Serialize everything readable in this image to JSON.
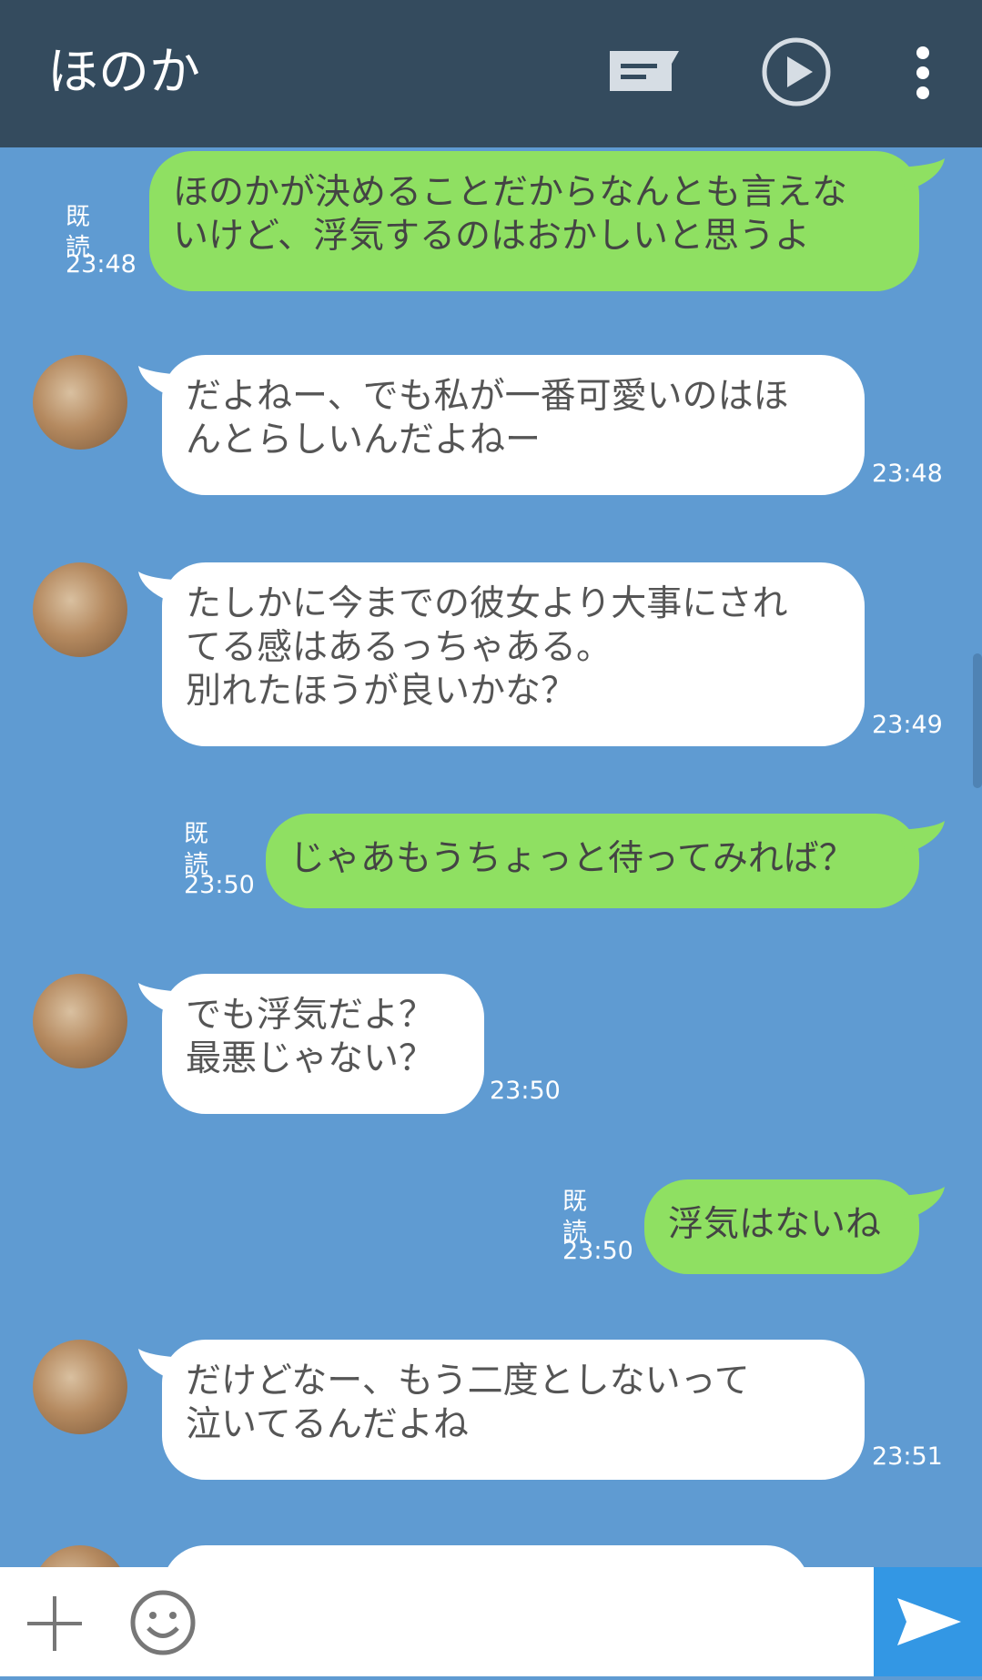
{
  "header": {
    "contact_name": "ほのか",
    "icons": [
      "chat-icon",
      "play-icon",
      "more-vertical-icon"
    ]
  },
  "messages": [
    {
      "side": "out",
      "text": "ほのかが決めることだからなんとも言えな\nいけど、浮気するのはおかしいと思うよ",
      "read": "既読",
      "time": "23:48"
    },
    {
      "side": "in",
      "text": "だよねー、でも私が一番可愛いのはほ\nんとらしいんだよねー",
      "time": "23:48"
    },
    {
      "side": "in",
      "text": "たしかに今までの彼女より大事にされ\nてる感はあるっちゃある。\n別れたほうが良いかな？",
      "time": "23:49"
    },
    {
      "side": "out",
      "text": "じゃあもうちょっと待ってみれば？",
      "read": "既読",
      "time": "23:50"
    },
    {
      "side": "in",
      "text": "でも浮気だよ？\n最悪じゃない？",
      "time": "23:50"
    },
    {
      "side": "out",
      "text": "浮気はないね",
      "read": "既読",
      "time": "23:50"
    },
    {
      "side": "in",
      "text": "だけどなー、もう二度としないって\n泣いてるんだよね",
      "time": "23:51"
    }
  ],
  "composer": {
    "icons": [
      "plus-icon",
      "emoji-icon",
      "send-icon"
    ]
  },
  "colors": {
    "header_bg": "#344b5e",
    "chat_bg": "#5f9bd2",
    "outgoing_bubble": "#8fe062",
    "incoming_bubble": "#ffffff",
    "send_button": "#3397e4"
  }
}
